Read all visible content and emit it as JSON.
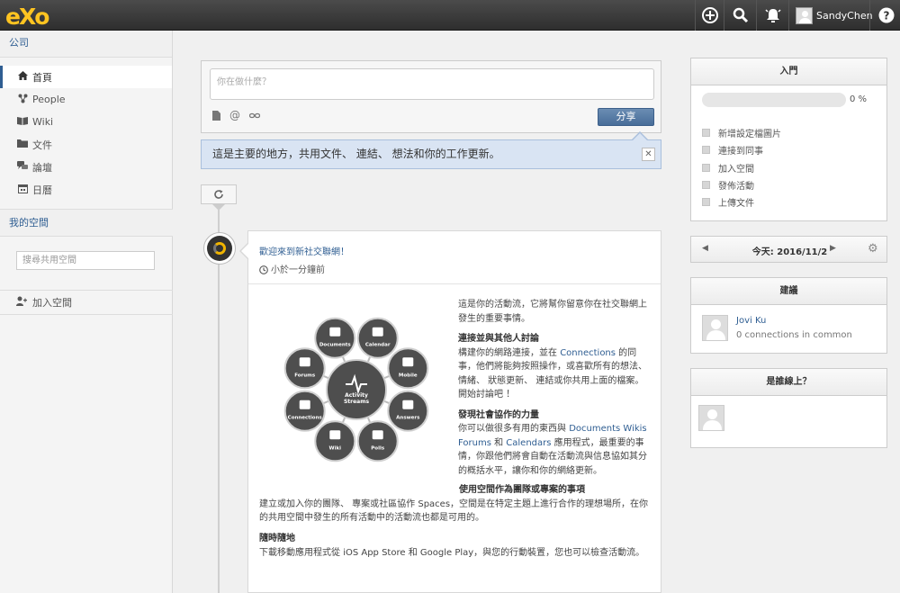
{
  "topbar": {
    "logo": "eXo",
    "user_name": "SandyChen",
    "icons": [
      "plus-circle-icon",
      "search-icon",
      "bell-icon",
      "help-icon"
    ]
  },
  "sidebar": {
    "company_header": "公司",
    "items": [
      {
        "label": "首頁",
        "icon": "home-icon",
        "active": true
      },
      {
        "label": "People",
        "icon": "people-icon",
        "active": false
      },
      {
        "label": "Wiki",
        "icon": "book-icon",
        "active": false
      },
      {
        "label": "文件",
        "icon": "folder-icon",
        "active": false
      },
      {
        "label": "論壇",
        "icon": "comments-icon",
        "active": false
      },
      {
        "label": "日曆",
        "icon": "calendar-icon",
        "active": false
      }
    ],
    "my_spaces_header": "我的空間",
    "search_placeholder": "搜尋共用空間",
    "join_space_label": "加入空間"
  },
  "composer": {
    "placeholder": "你在做什麼？",
    "share_label": "分享"
  },
  "tip": {
    "text": "這是主要的地方，共用文件、 連結、 想法和你的工作更新。",
    "close": "✕"
  },
  "activity": {
    "title": "歡迎來到新社交聯網！",
    "time": "小於一分鐘前",
    "diagram": {
      "center": "Activity Streams",
      "nodes": [
        "Documents",
        "Calendar",
        "Mobile",
        "Answers",
        "Polls",
        "Wiki",
        "Connections",
        "Forums"
      ]
    },
    "intro": "這是你的活動流，它將幫你留意你在社交聯網上發生的重要事情。",
    "s1_title": "連接並與其他人討論",
    "s1_a": "構建你的網路連接，並在 ",
    "s1_link": "Connections",
    "s1_b": " 的同事，他們將能夠按照操作，或喜歡所有的想法、 情緒、 狀態更新、 連結或你共用上面的檔案。開始討論吧 ！",
    "s2_title": "發現社會協作的力量",
    "s2_a": "你可以做很多有用的東西與 ",
    "s2_link1": "Documents",
    "s2_link2": "Wikis",
    "s2_link3": "Forums",
    "s2_and": " 和 ",
    "s2_link4": "Calendars",
    "s2_b": " 應用程式，最重要的事情，你跟他們將會自動在活動流與信息協如其分的概括水平，讓你和你的網絡更新。",
    "s3_title": "使用空間作為團隊或專案的事項",
    "s3_a": "建立或加入你的團隊、 專案或社區協作 ",
    "s3_link": "Spaces",
    "s3_b": "，空間是在特定主題上進行合作的理想場所，在你的共用空間中發生的所有活動中的活動流也都是可用的。",
    "s4_title": "隨時隨地",
    "s4_a": "下載移動應用程式從 ",
    "s4_link1": "iOS App Store",
    "s4_and": " 和 ",
    "s4_link2": "Google Play",
    "s4_b": "，與您的行動裝置，您也可以檢查活動流。"
  },
  "getting_started": {
    "title": "入門",
    "progress": 0,
    "progress_label": "0 %",
    "items": [
      "新增設定檔圖片",
      "連接到同事",
      "加入空間",
      "發佈活動",
      "上傳文件"
    ]
  },
  "calendar": {
    "label": "今天: 2016/11/2"
  },
  "suggestions": {
    "title": "建議",
    "person_name": "Jovi Ku",
    "person_meta": "0 connections in common"
  },
  "whos_online": {
    "title": "是誰線上？"
  },
  "colors": {
    "brand": "#ffc421",
    "link": "#2f5e92",
    "button": "#486d99"
  }
}
